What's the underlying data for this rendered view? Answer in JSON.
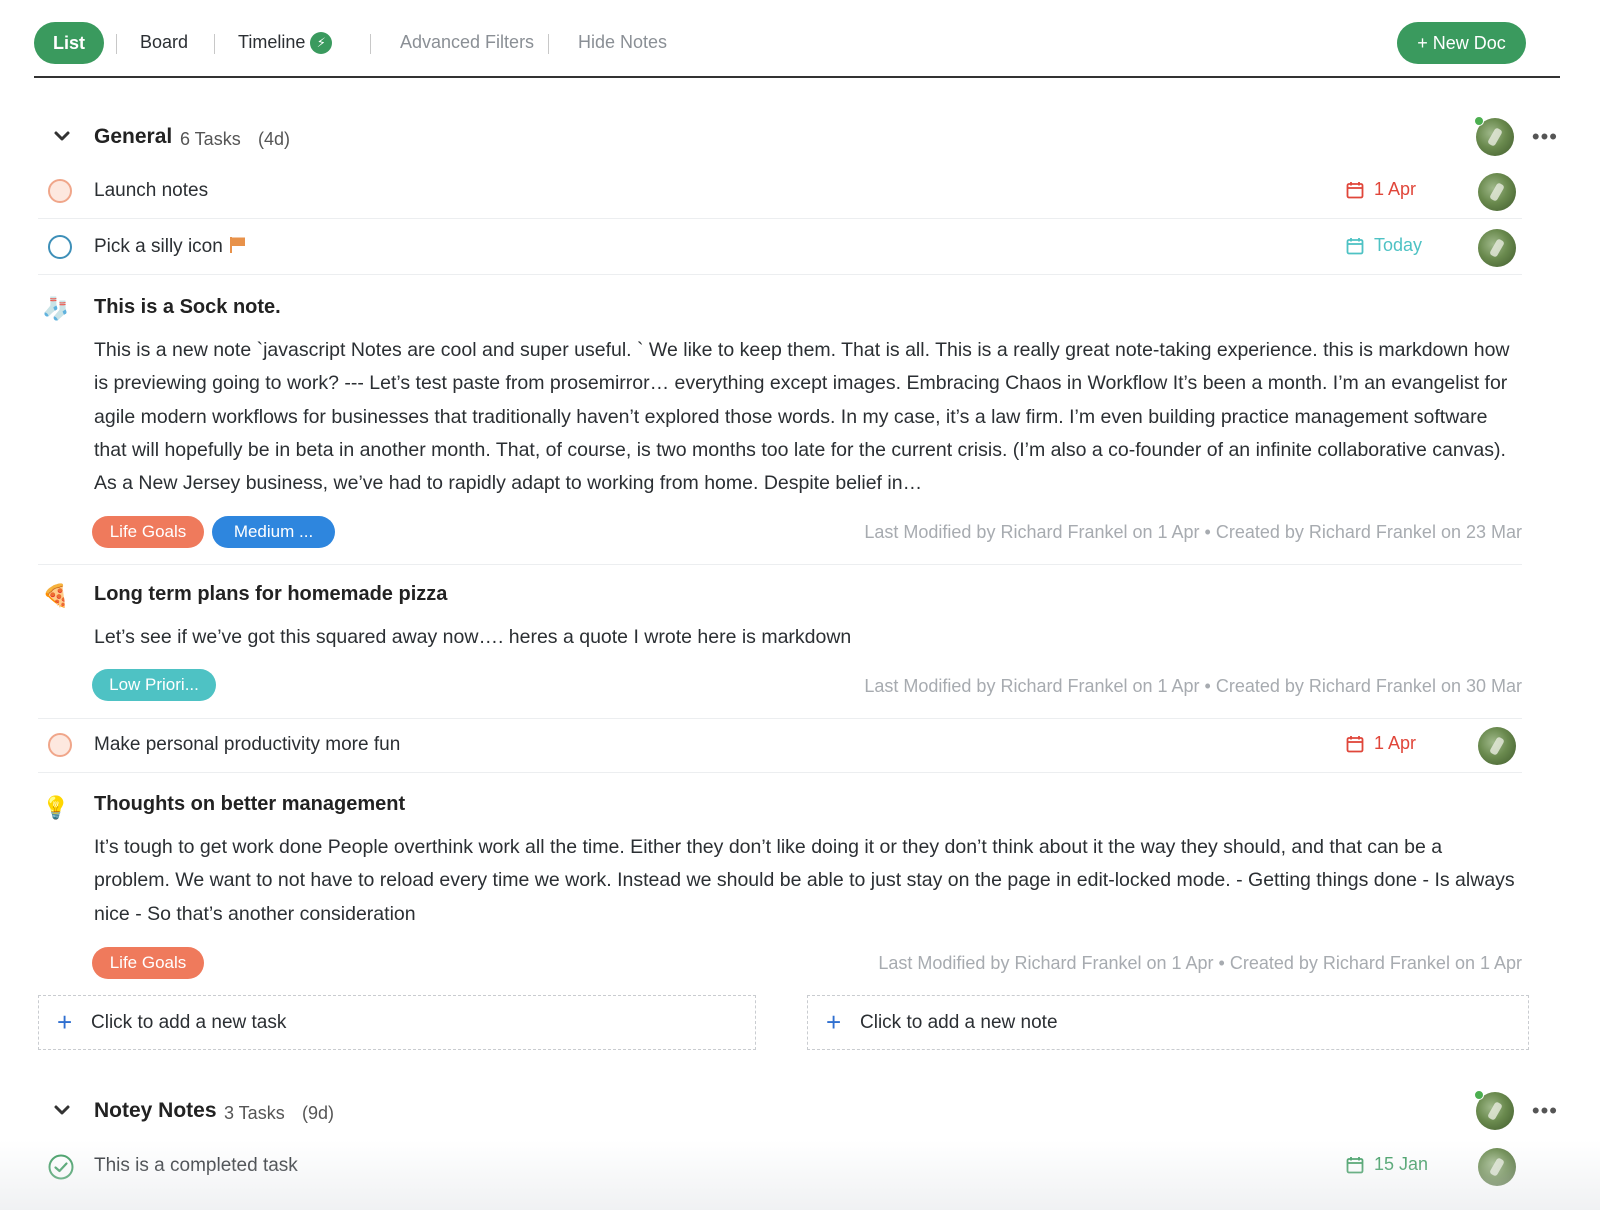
{
  "toolbar": {
    "tabs": [
      "List",
      "Board",
      "Timeline"
    ],
    "filters": [
      "Advanced Filters",
      "Hide Notes"
    ],
    "new_doc": "+ New Doc"
  },
  "groups": [
    {
      "title": "General",
      "count": "6 Tasks",
      "days": "(4d)",
      "tasks": [
        {
          "title": "Launch notes",
          "date": "1 Apr",
          "status": "open-overdue",
          "date_color": "#e0463a"
        },
        {
          "title": "Pick a silly icon",
          "date": "Today",
          "status": "open-today",
          "date_color": "#4ec2c4"
        },
        {
          "title": "Make personal productivity more fun",
          "date": "1 Apr",
          "status": "open-overdue",
          "date_color": "#e0463a"
        }
      ],
      "notes": [
        {
          "icon": "🧦",
          "title": "This is a Sock note.",
          "body": "This is a new note `javascript Notes are cool and super useful. ` We like to keep them. That is all. This is a really great note-taking experience. this is markdown how is previewing going to work? --- Let’s test paste from prosemirror… everything except images. Embracing Chaos in Workflow It’s been a month. I’m an evangelist for agile modern workflows for businesses that traditionally haven’t explored those words. In my case, it’s a law firm. I’m even building practice management software that will hopefully be in beta in another month. That, of course, is two months too late for the current crisis. (I’m also a co-founder of an infinite collaborative canvas). As a New Jersey business, we’ve had to rapidly adapt to working from home. Despite belief in…",
          "tags": [
            {
              "label": "Life Goals",
              "color": "#ef7a5c"
            },
            {
              "label": "Medium ...",
              "color": "#2e86de"
            }
          ],
          "meta": "Last Modified by Richard Frankel on 1 Apr • Created by Richard Frankel on 23 Mar"
        },
        {
          "icon": "🍕",
          "title": "Long term plans for homemade pizza",
          "body": "Let’s see if we’ve got this squared away now…. heres a quote I wrote here is markdown",
          "tags": [
            {
              "label": "Low Priori...",
              "color": "#4ec2c4"
            }
          ],
          "meta": "Last Modified by Richard Frankel on 1 Apr • Created by Richard Frankel on 30 Mar"
        },
        {
          "icon": "💡",
          "title": "Thoughts on better management",
          "body": "It’s tough to get work done People overthink work all the time. Either they don’t like doing it or they don’t think about it the way they should, and that can be a problem. We want to not have to reload every time we work. Instead we should be able to just stay on the page in edit-locked mode. - Getting things done - Is always nice - So that’s another consideration",
          "tags": [
            {
              "label": "Life Goals",
              "color": "#ef7a5c"
            }
          ],
          "meta": "Last Modified by Richard Frankel on 1 Apr • Created by Richard Frankel on 1 Apr"
        }
      ],
      "add_task": "Click to add a new task",
      "add_note": "Click to add a new note"
    },
    {
      "title": "Notey Notes",
      "count": "3 Tasks",
      "days": "(9d)",
      "tasks": [
        {
          "title": "This is a completed task",
          "date": "15 Jan",
          "status": "complete",
          "date_color": "#3a9a5e"
        }
      ]
    }
  ],
  "colors": {
    "accent_green": "#3a9a5e",
    "overdue_red": "#e0463a",
    "today_teal": "#4ec2c4",
    "link_blue": "#2f6fd0"
  }
}
